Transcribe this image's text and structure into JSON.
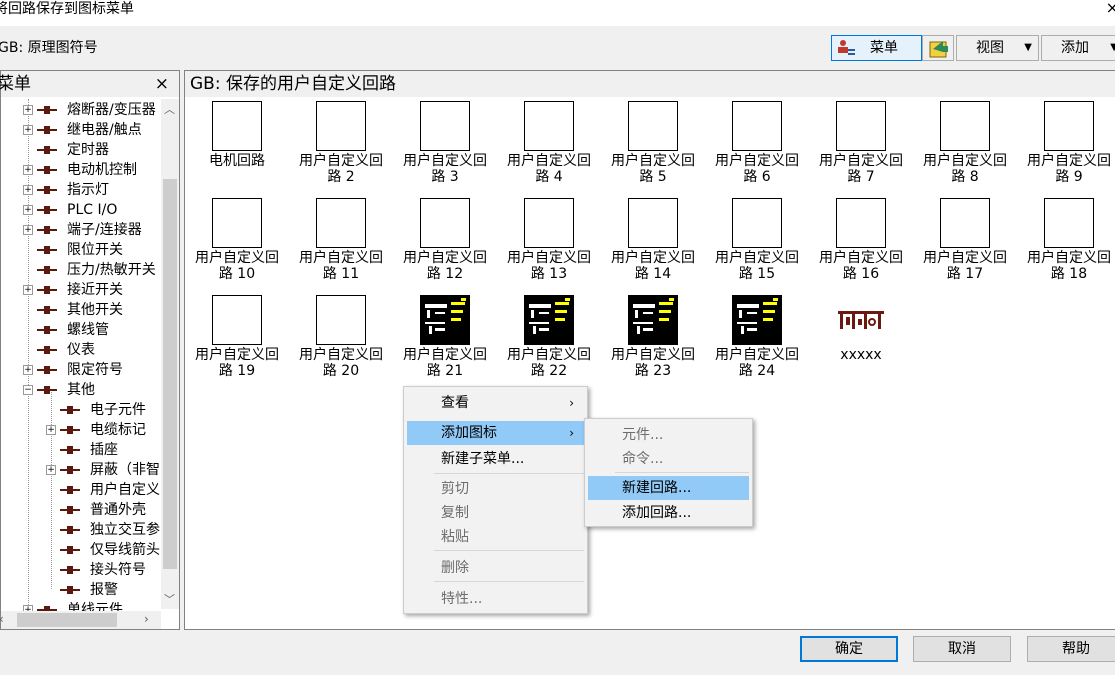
{
  "window": {
    "title": "将回路保存到图标菜单",
    "close_glyph": "×"
  },
  "toolbar": {
    "path": "GB: 原理图符号",
    "menu_label": "菜单",
    "view_label": "视图",
    "add_label": "添加",
    "dropdown_glyph": "▼"
  },
  "left_panel": {
    "header": "菜单",
    "close_glyph": "×",
    "items": [
      {
        "label": "熔断器/变压器",
        "expandable": true,
        "level": 1
      },
      {
        "label": "继电器/触点",
        "expandable": true,
        "level": 1
      },
      {
        "label": "定时器",
        "expandable": false,
        "level": 1
      },
      {
        "label": "电动机控制",
        "expandable": true,
        "level": 1
      },
      {
        "label": "指示灯",
        "expandable": true,
        "level": 1
      },
      {
        "label": "PLC I/O",
        "expandable": true,
        "level": 1
      },
      {
        "label": "端子/连接器",
        "expandable": true,
        "level": 1
      },
      {
        "label": "限位开关",
        "expandable": false,
        "level": 1
      },
      {
        "label": "压力/热敏开关",
        "expandable": false,
        "level": 1
      },
      {
        "label": "接近开关",
        "expandable": true,
        "level": 1
      },
      {
        "label": "其他开关",
        "expandable": false,
        "level": 1
      },
      {
        "label": "螺线管",
        "expandable": false,
        "level": 1
      },
      {
        "label": "仪表",
        "expandable": false,
        "level": 1
      },
      {
        "label": "限定符号",
        "expandable": true,
        "level": 1
      },
      {
        "label": "其他",
        "expandable": true,
        "expanded": true,
        "level": 1
      },
      {
        "label": "电子元件",
        "expandable": false,
        "level": 2
      },
      {
        "label": "电缆标记",
        "expandable": true,
        "level": 2
      },
      {
        "label": "插座",
        "expandable": false,
        "level": 2
      },
      {
        "label": "屏蔽（非智",
        "expandable": true,
        "level": 2
      },
      {
        "label": "用户自定义",
        "expandable": false,
        "level": 2
      },
      {
        "label": "普通外壳",
        "expandable": false,
        "level": 2
      },
      {
        "label": "独立交互参",
        "expandable": false,
        "level": 2
      },
      {
        "label": "仅导线箭头",
        "expandable": false,
        "level": 2
      },
      {
        "label": "接头符号",
        "expandable": false,
        "level": 2
      },
      {
        "label": "报警",
        "expandable": false,
        "level": 2
      },
      {
        "label": "单线元件",
        "expandable": true,
        "level": 1
      }
    ]
  },
  "right_panel": {
    "header": "GB: 保存的用户自定义回路",
    "icons": [
      {
        "line1": "电机回路",
        "line2": "",
        "style": "blank"
      },
      {
        "line1": "用户自定义回",
        "line2": "路 2",
        "style": "blank"
      },
      {
        "line1": "用户自定义回",
        "line2": "路 3",
        "style": "blank"
      },
      {
        "line1": "用户自定义回",
        "line2": "路 4",
        "style": "blank"
      },
      {
        "line1": "用户自定义回",
        "line2": "路 5",
        "style": "blank"
      },
      {
        "line1": "用户自定义回",
        "line2": "路 6",
        "style": "blank"
      },
      {
        "line1": "用户自定义回",
        "line2": "路 7",
        "style": "blank"
      },
      {
        "line1": "用户自定义回",
        "line2": "路 8",
        "style": "blank"
      },
      {
        "line1": "用户自定义回",
        "line2": "路 9",
        "style": "blank"
      },
      {
        "line1": "用户自定义回",
        "line2": "路 10",
        "style": "blank"
      },
      {
        "line1": "用户自定义回",
        "line2": "路 11",
        "style": "blank"
      },
      {
        "line1": "用户自定义回",
        "line2": "路 12",
        "style": "blank"
      },
      {
        "line1": "用户自定义回",
        "line2": "路 13",
        "style": "blank"
      },
      {
        "line1": "用户自定义回",
        "line2": "路 14",
        "style": "blank"
      },
      {
        "line1": "用户自定义回",
        "line2": "路 15",
        "style": "blank"
      },
      {
        "line1": "用户自定义回",
        "line2": "路 16",
        "style": "blank"
      },
      {
        "line1": "用户自定义回",
        "line2": "路 17",
        "style": "blank"
      },
      {
        "line1": "用户自定义回",
        "line2": "路 18",
        "style": "blank"
      },
      {
        "line1": "用户自定义回",
        "line2": "路 19",
        "style": "blank"
      },
      {
        "line1": "用户自定义回",
        "line2": "路 20",
        "style": "blank"
      },
      {
        "line1": "用户自定义回",
        "line2": "路 21",
        "style": "dark"
      },
      {
        "line1": "用户自定义回",
        "line2": "路 22",
        "style": "dark"
      },
      {
        "line1": "用户自定义回",
        "line2": "路 23",
        "style": "dark"
      },
      {
        "line1": "用户自定义回",
        "line2": "路 24",
        "style": "dark"
      },
      {
        "line1": "xxxxx",
        "line2": "",
        "style": "symbol"
      }
    ]
  },
  "context_menu": {
    "items": [
      {
        "label": "查看",
        "submenu": true,
        "disabled": false
      },
      {
        "label": "添加图标",
        "submenu": true,
        "disabled": false,
        "highlighted": true
      },
      {
        "label": "新建子菜单...",
        "submenu": false,
        "disabled": false
      },
      {
        "label": "剪切",
        "submenu": false,
        "disabled": true
      },
      {
        "label": "复制",
        "submenu": false,
        "disabled": true
      },
      {
        "label": "粘贴",
        "submenu": false,
        "disabled": true
      },
      {
        "label": "删除",
        "submenu": false,
        "disabled": true
      },
      {
        "label": "特性...",
        "submenu": false,
        "disabled": true
      }
    ],
    "submenu_glyph": "›"
  },
  "submenu": {
    "items": [
      {
        "label": "元件...",
        "disabled": true
      },
      {
        "label": "命令...",
        "disabled": true
      },
      {
        "label": "新建回路...",
        "disabled": false,
        "highlighted": true
      },
      {
        "label": "添加回路...",
        "disabled": false
      }
    ]
  },
  "buttons": {
    "ok": "确定",
    "cancel": "取消",
    "help": "帮助"
  },
  "colors": {
    "highlight": "#91c9f7",
    "accent": "#0078d7",
    "tree_symbol": "#5a1a0f",
    "dark_icon_bg": "#000000"
  }
}
